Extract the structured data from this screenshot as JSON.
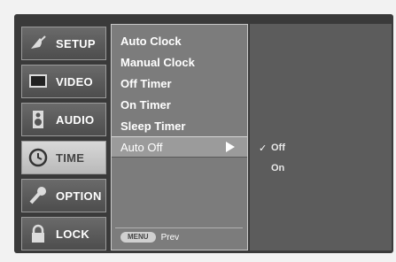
{
  "sidebar": {
    "items": [
      {
        "label": "SETUP",
        "icon": "satellite-dish-icon"
      },
      {
        "label": "VIDEO",
        "icon": "tv-screen-icon"
      },
      {
        "label": "AUDIO",
        "icon": "speaker-icon"
      },
      {
        "label": "TIME",
        "icon": "clock-icon"
      },
      {
        "label": "OPTION",
        "icon": "wrench-icon"
      },
      {
        "label": "LOCK",
        "icon": "padlock-icon"
      }
    ],
    "active_index": 3
  },
  "menu": {
    "items": [
      {
        "label": "Auto Clock"
      },
      {
        "label": "Manual Clock"
      },
      {
        "label": "Off Timer"
      },
      {
        "label": "On Timer"
      },
      {
        "label": "Sleep Timer"
      },
      {
        "label": "Auto Off"
      }
    ],
    "selected_index": 5,
    "footer": {
      "key_label": "MENU",
      "text": "Prev"
    }
  },
  "submenu": {
    "options": [
      {
        "label": "Off",
        "checked": true
      },
      {
        "label": "On",
        "checked": false
      }
    ],
    "check_mark": "✓"
  }
}
